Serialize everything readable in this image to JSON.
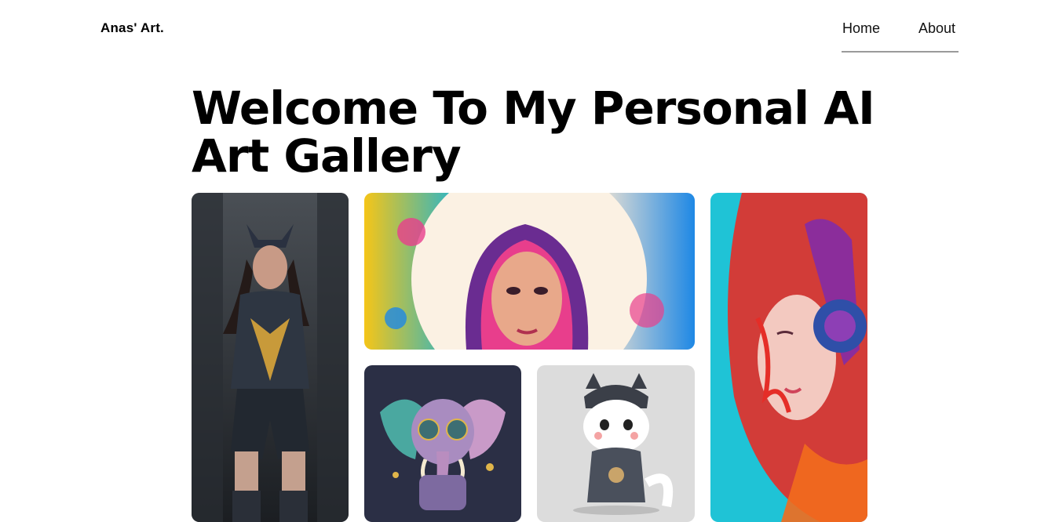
{
  "header": {
    "brand": "Anas' Art.",
    "nav": [
      {
        "label": "Home"
      },
      {
        "label": "About"
      }
    ]
  },
  "hero": {
    "title": "Welcome To My Personal AI Art Gallery"
  },
  "gallery": {
    "items": [
      {
        "subject": "armored-heroine-art",
        "palette": [
          "#3a3f44",
          "#1c2024",
          "#c89a3a",
          "#2f3d57"
        ]
      },
      {
        "subject": "colorful-splash-portrait",
        "palette": [
          "#f6e6d2",
          "#e83e8c",
          "#6a2c91",
          "#18b3d6",
          "#f5c518"
        ]
      },
      {
        "subject": "headphones-splash-portrait",
        "palette": [
          "#1fc3d6",
          "#e52d27",
          "#2f4fa8",
          "#f7a2a2"
        ]
      },
      {
        "subject": "elephant-with-glasses",
        "palette": [
          "#2b2f45",
          "#c99ac8",
          "#4aa8a0",
          "#e0b54a"
        ]
      },
      {
        "subject": "pirate-cat",
        "palette": [
          "#dcdcdc",
          "#3b3f48",
          "#ffffff",
          "#c9a46a"
        ]
      }
    ]
  }
}
